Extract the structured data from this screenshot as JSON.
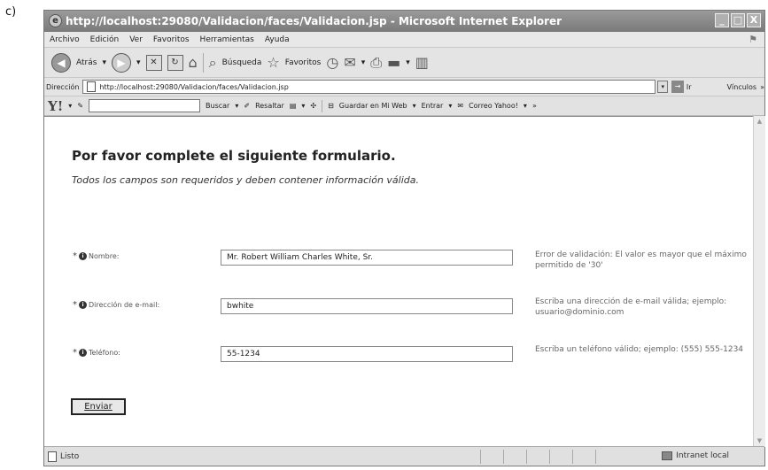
{
  "figure_label": "c)",
  "window": {
    "title": "http://localhost:29080/Validacion/faces/Validacion.jsp - Microsoft Internet Explorer",
    "icon": "ie-icon",
    "buttons": [
      "_",
      "□",
      "X"
    ]
  },
  "menu": {
    "items": [
      "Archivo",
      "Edición",
      "Ver",
      "Favoritos",
      "Herramientas",
      "Ayuda"
    ]
  },
  "toolbar": {
    "back_label": "Atrás",
    "search_label": "Búsqueda",
    "favorites_label": "Favoritos"
  },
  "address": {
    "label": "Dirección",
    "url": "http://localhost:29080/Validacion/faces/Validacion.jsp",
    "go_label": "Ir",
    "links_label": "Vínculos"
  },
  "yahoo": {
    "logo": "Y!",
    "search_btn": "Buscar",
    "highlight": "Resaltar",
    "save": "Guardar en Mi Web",
    "enter": "Entrar",
    "mail": "Correo Yahoo!"
  },
  "form": {
    "heading": "Por favor complete el siguiente formulario.",
    "subheading": "Todos los campos son requeridos y deben contener información válida.",
    "fields": [
      {
        "label": "Nombre:",
        "value": "Mr. Robert William Charles White, Sr.",
        "message": "Error de validación: El valor es mayor que el máximo permitido de '30'"
      },
      {
        "label": "Dirección de e-mail:",
        "value": "bwhite",
        "message": "Escriba una dirección de e-mail válida; ejemplo: usuario@dominio.com"
      },
      {
        "label": "Teléfono:",
        "value": "55-1234",
        "message": "Escriba un teléfono válido; ejemplo: (555) 555-1234"
      }
    ],
    "submit_label": "Enviar"
  },
  "status": {
    "text": "Listo",
    "zone": "Intranet local"
  }
}
